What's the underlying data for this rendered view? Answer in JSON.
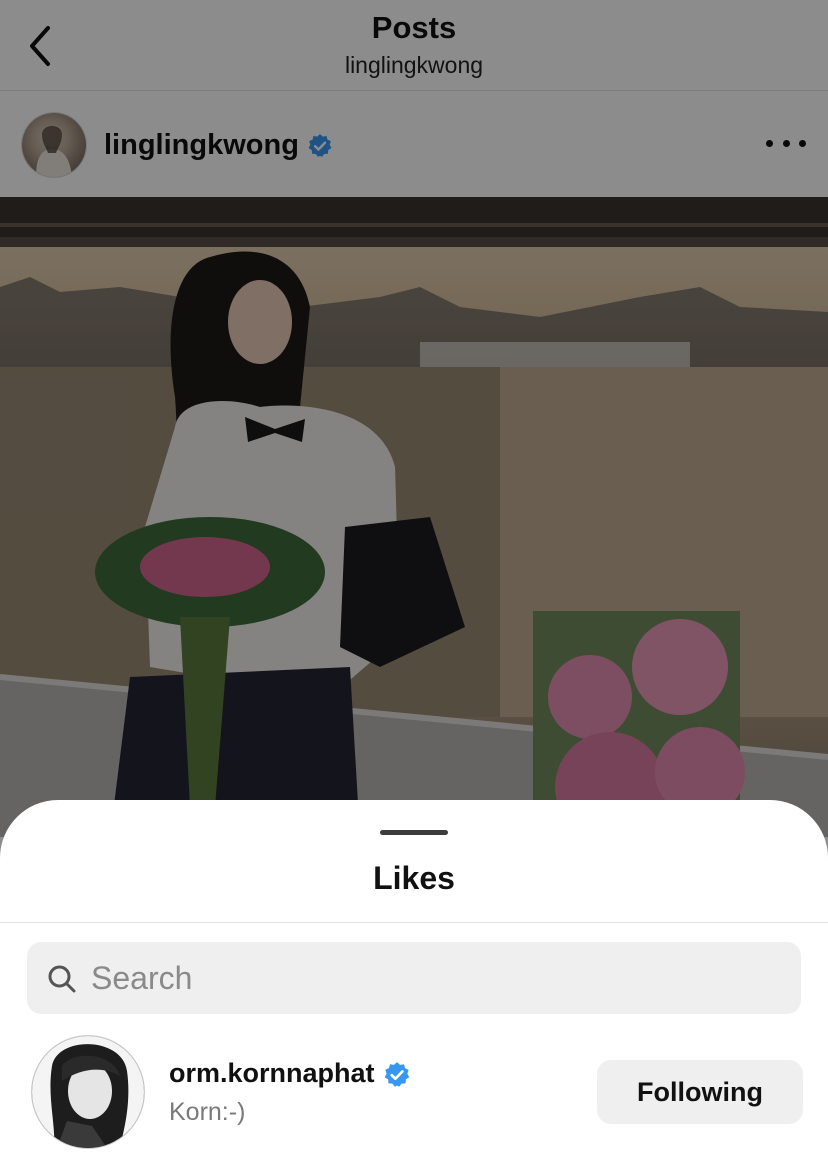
{
  "header": {
    "title": "Posts",
    "subtitle": "linglingkwong",
    "back_icon": "chevron-left-icon"
  },
  "post": {
    "author": "linglingkwong",
    "verified": true,
    "more_icon": "more-horizontal-icon"
  },
  "likes_sheet": {
    "title": "Likes",
    "search": {
      "placeholder": "Search",
      "value": ""
    },
    "users": [
      {
        "username": "orm.kornnaphat",
        "verified": true,
        "full_name": "Korn:-)",
        "button_label": "Following"
      }
    ]
  },
  "colors": {
    "verified_blue": "#3897f0",
    "dim_overlay": "rgba(0,0,0,0.45)",
    "button_bg": "#efefef"
  }
}
